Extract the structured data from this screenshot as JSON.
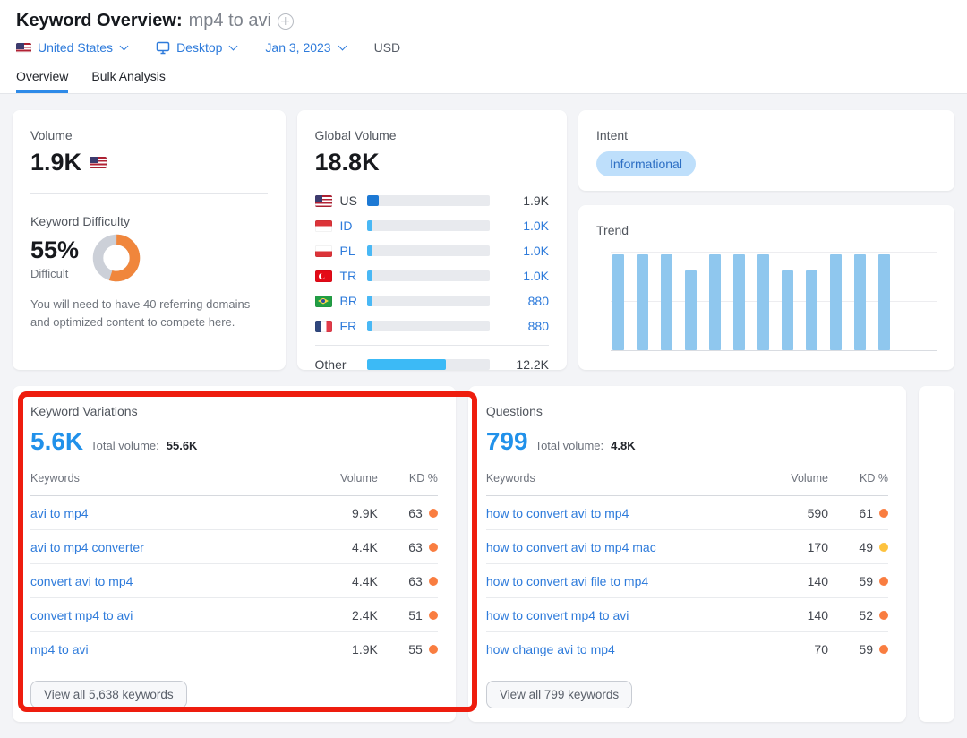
{
  "header": {
    "title": "Keyword Overview:",
    "keyword": "mp4 to avi",
    "location": "United States",
    "device": "Desktop",
    "date": "Jan 3, 2023",
    "currency": "USD",
    "tabs": [
      {
        "label": "Overview",
        "active": true
      },
      {
        "label": "Bulk Analysis",
        "active": false
      }
    ]
  },
  "volume_card": {
    "label": "Volume",
    "value": "1.9K",
    "country_flag": "us",
    "kd": {
      "label": "Keyword Difficulty",
      "value": "55%",
      "percent": 55,
      "level": "Difficult",
      "note": "You will need to have 40 referring domains and optimized content to compete here.",
      "ring_color": "#f0863c",
      "ring_track_color": "#ccd0d8"
    }
  },
  "global_volume_card": {
    "label": "Global Volume",
    "value": "18.8K",
    "rows": [
      {
        "code": "us",
        "label": "US",
        "value": "1.9K",
        "bar_pct": 10,
        "bar_color": "#1d79d4",
        "emphasis": true
      },
      {
        "code": "id",
        "label": "ID",
        "value": "1.0K",
        "bar_pct": 4.5,
        "bar_color": "#49b8f5",
        "emphasis": false
      },
      {
        "code": "pl",
        "label": "PL",
        "value": "1.0K",
        "bar_pct": 4.5,
        "bar_color": "#49b8f5",
        "emphasis": false
      },
      {
        "code": "tr",
        "label": "TR",
        "value": "1.0K",
        "bar_pct": 4.5,
        "bar_color": "#49b8f5",
        "emphasis": false
      },
      {
        "code": "br",
        "label": "BR",
        "value": "880",
        "bar_pct": 4.5,
        "bar_color": "#49b8f5",
        "emphasis": false
      },
      {
        "code": "fr",
        "label": "FR",
        "value": "880",
        "bar_pct": 4.5,
        "bar_color": "#49b8f5",
        "emphasis": false
      }
    ],
    "other_row": {
      "label": "Other",
      "value": "12.2K",
      "bar_pct": 64,
      "bar_color": "#3cbaf6",
      "emphasis": true
    }
  },
  "intent_card": {
    "label": "Intent",
    "badge": "Informational",
    "badge_bg": "#bedffb",
    "badge_color": "#2d6fc4"
  },
  "trend_card": {
    "label": "Trend",
    "chart_data": {
      "type": "bar",
      "series": [
        {
          "name": "relative monthly search volume",
          "values": [
            1,
            1,
            1,
            0.83,
            1,
            1,
            1,
            0.83,
            0.83,
            1,
            1,
            1
          ]
        }
      ],
      "title": "Trend",
      "xlabel": "",
      "ylabel": "",
      "ylim": [
        0,
        1
      ],
      "bar_color": "#8fc7ee",
      "grid": true,
      "note": "sparkline without axis labels; right side clipped by viewport"
    }
  },
  "keyword_variations_card": {
    "label": "Keyword Variations",
    "count": "5.6K",
    "total_volume_label": "Total volume:",
    "total_volume": "55.6K",
    "columns": {
      "keyword": "Keywords",
      "volume": "Volume",
      "kd": "KD %"
    },
    "rows": [
      {
        "keyword": "avi to mp4",
        "volume": "9.9K",
        "kd": "63",
        "kd_dot_color": "#f97d40"
      },
      {
        "keyword": "avi to mp4 converter",
        "volume": "4.4K",
        "kd": "63",
        "kd_dot_color": "#f97d40"
      },
      {
        "keyword": "convert avi to mp4",
        "volume": "4.4K",
        "kd": "63",
        "kd_dot_color": "#f97d40"
      },
      {
        "keyword": "convert mp4 to avi",
        "volume": "2.4K",
        "kd": "51",
        "kd_dot_color": "#f97d40"
      },
      {
        "keyword": "mp4 to avi",
        "volume": "1.9K",
        "kd": "55",
        "kd_dot_color": "#f97d40"
      }
    ],
    "view_all_label": "View all 5,638 keywords"
  },
  "questions_card": {
    "label": "Questions",
    "count": "799",
    "total_volume_label": "Total volume:",
    "total_volume": "4.8K",
    "columns": {
      "keyword": "Keywords",
      "volume": "Volume",
      "kd": "KD %"
    },
    "rows": [
      {
        "keyword": "how to convert avi to mp4",
        "volume": "590",
        "kd": "61",
        "kd_dot_color": "#f97d40"
      },
      {
        "keyword": "how to convert avi to mp4 mac",
        "volume": "170",
        "kd": "49",
        "kd_dot_color": "#fdc23e"
      },
      {
        "keyword": "how to convert avi file to mp4",
        "volume": "140",
        "kd": "59",
        "kd_dot_color": "#f97d40"
      },
      {
        "keyword": "how to convert mp4 to avi",
        "volume": "140",
        "kd": "52",
        "kd_dot_color": "#f97d40"
      },
      {
        "keyword": "how change avi to mp4",
        "volume": "70",
        "kd": "59",
        "kd_dot_color": "#f97d40"
      }
    ],
    "view_all_label": "View all 799 keywords"
  },
  "annotation": {
    "color": "#ee1d0e"
  }
}
